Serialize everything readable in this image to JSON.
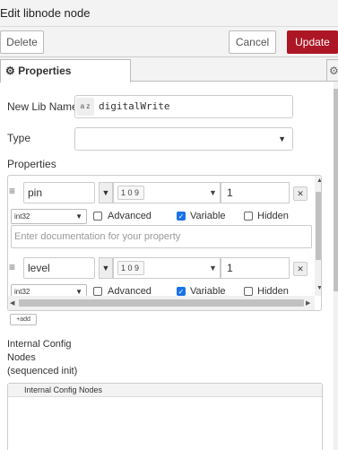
{
  "window": {
    "title": "Edit libnode node"
  },
  "buttons": {
    "delete": "Delete",
    "cancel": "Cancel",
    "update": "Update"
  },
  "tabs": {
    "properties": "Properties"
  },
  "form": {
    "lib_name_label": "New Lib Name",
    "lib_name_value": "digitalWrite",
    "az_icon_text": "a z",
    "type_label": "Type",
    "type_value": "",
    "properties_label": "Properties"
  },
  "properties": [
    {
      "name": "pin",
      "value": "1",
      "datatype": "int32",
      "advanced_label": "Advanced",
      "variable_label": "Variable",
      "hidden_label": "Hidden",
      "advanced": false,
      "variable": true,
      "hidden": false,
      "doc_placeholder": "Enter documentation for your property"
    },
    {
      "name": "level",
      "value": "1",
      "datatype": "int32",
      "advanced_label": "Advanced",
      "variable_label": "Variable",
      "hidden_label": "Hidden",
      "advanced": false,
      "variable": true,
      "hidden": false
    }
  ],
  "typed_input_icon": "1 0 9",
  "add_button": "+add",
  "internal_config": {
    "label_line1": "Internal Config",
    "label_line2": "Nodes",
    "label_line3": "(sequenced init)",
    "header": "Internal Config Nodes"
  }
}
